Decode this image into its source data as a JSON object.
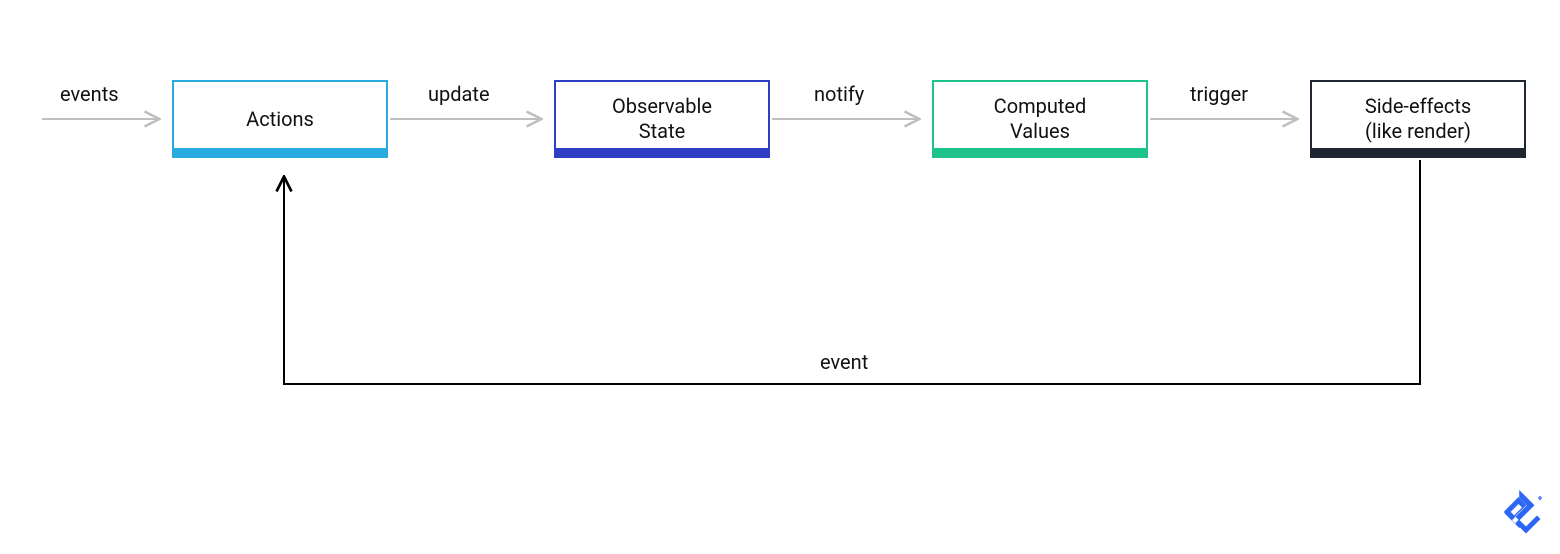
{
  "nodes": {
    "actions": {
      "label": "Actions",
      "border": "#29ABE2",
      "underline": "#29ABE2"
    },
    "state": {
      "label": "Observable\nState",
      "border": "#2E3FC6",
      "underline": "#2E3FC6"
    },
    "computed": {
      "label": "Computed\nValues",
      "border": "#1EC28B",
      "underline": "#1EC28B"
    },
    "effects": {
      "label": "Side-effects\n(like render)",
      "border": "#1F2733",
      "underline": "#1F2733"
    }
  },
  "edges": {
    "events": "events",
    "update": "update",
    "notify": "notify",
    "trigger": "trigger",
    "event": "event"
  },
  "colors": {
    "gray_arrow": "#BFBFBF",
    "black_arrow": "#000000",
    "logo": "#2D66F5"
  }
}
